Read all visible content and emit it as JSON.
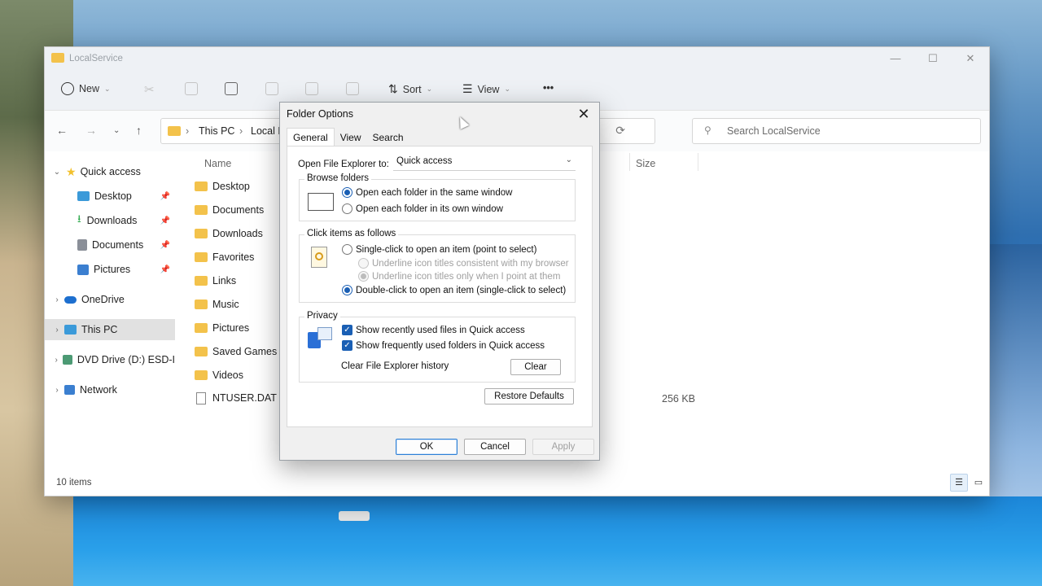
{
  "window": {
    "title": "LocalService",
    "controls": {
      "minimize": "—",
      "maximize": "☐",
      "close": "✕"
    }
  },
  "toolbar": {
    "new_label": "New",
    "sort_label": "Sort",
    "view_label": "View",
    "more_label": "•••"
  },
  "address": {
    "crumbs": [
      "This PC",
      "Local D"
    ]
  },
  "search": {
    "placeholder": "Search LocalService"
  },
  "sidebar": {
    "items": [
      {
        "label": "Quick access",
        "icon": "star-icon",
        "color": "#f2c12e"
      },
      {
        "label": "Desktop",
        "icon": "desktop-icon",
        "color": "#3b9ad9"
      },
      {
        "label": "Downloads",
        "icon": "download-icon",
        "color": "#2ba84a"
      },
      {
        "label": "Documents",
        "icon": "documents-icon",
        "color": "#8a8f98"
      },
      {
        "label": "Pictures",
        "icon": "pictures-icon",
        "color": "#3b7fd0"
      },
      {
        "label": "OneDrive",
        "icon": "cloud-icon",
        "color": "#1d6fcf"
      },
      {
        "label": "This PC",
        "icon": "pc-icon",
        "color": "#3b9ad9"
      },
      {
        "label": "DVD Drive (D:) ESD-I",
        "icon": "dvd-icon",
        "color": "#4c9a74"
      },
      {
        "label": "Network",
        "icon": "network-icon",
        "color": "#3b7fd0"
      }
    ]
  },
  "columns": {
    "name": "Name",
    "size": "Size"
  },
  "files": [
    {
      "name": "Desktop",
      "type": "folder"
    },
    {
      "name": "Documents",
      "type": "folder"
    },
    {
      "name": "Downloads",
      "type": "folder"
    },
    {
      "name": "Favorites",
      "type": "folder"
    },
    {
      "name": "Links",
      "type": "folder"
    },
    {
      "name": "Music",
      "type": "folder"
    },
    {
      "name": "Pictures",
      "type": "folder"
    },
    {
      "name": "Saved Games",
      "type": "folder"
    },
    {
      "name": "Videos",
      "type": "folder"
    },
    {
      "name": "NTUSER.DAT",
      "type": "file",
      "size": "256 KB"
    }
  ],
  "status": {
    "count": "10 items"
  },
  "dialog": {
    "title": "Folder Options",
    "tabs": [
      "General",
      "View",
      "Search"
    ],
    "open_to_label": "Open File Explorer to:",
    "open_to_value": "Quick access",
    "browse": {
      "label": "Browse folders",
      "options": [
        "Open each folder in the same window",
        "Open each folder in its own window"
      ],
      "selected": 0
    },
    "click": {
      "label": "Click items as follows",
      "single": "Single-click to open an item (point to select)",
      "underline_browser": "Underline icon titles consistent with my browser",
      "underline_point": "Underline icon titles only when I point at them",
      "double": "Double-click to open an item (single-click to select)"
    },
    "privacy": {
      "label": "Privacy",
      "recent_files": "Show recently used files in Quick access",
      "frequent_folders": "Show frequently used folders in Quick access",
      "clear_label": "Clear File Explorer history",
      "clear_button": "Clear"
    },
    "restore_button": "Restore Defaults",
    "ok": "OK",
    "cancel": "Cancel",
    "apply": "Apply"
  },
  "colors": {
    "accent": "#1a5fb4",
    "folder": "#f3c24b"
  }
}
